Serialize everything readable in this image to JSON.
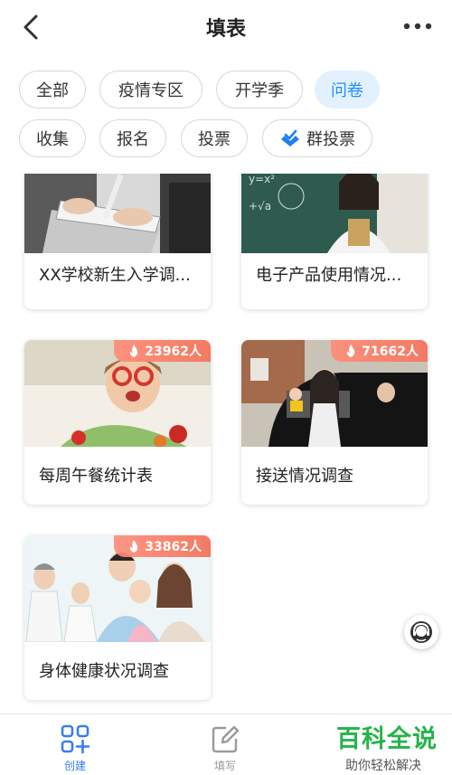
{
  "header": {
    "title": "填表",
    "back_icon": "chevron-left-icon",
    "more_icon": "more-dots-icon"
  },
  "chips": [
    {
      "label": "全部",
      "active": false
    },
    {
      "label": "疫情专区",
      "active": false
    },
    {
      "label": "开学季",
      "active": false
    },
    {
      "label": "问卷",
      "active": true
    },
    {
      "label": "收集",
      "active": false
    },
    {
      "label": "报名",
      "active": false
    },
    {
      "label": "投票",
      "active": false
    },
    {
      "label": "群投票",
      "active": false,
      "icon": "vote-box-icon"
    }
  ],
  "cards": [
    {
      "title": "XX学校新生入学调...",
      "count": ""
    },
    {
      "title": "电子产品使用情况...",
      "count": ""
    },
    {
      "title": "每周午餐统计表",
      "count": "23962人"
    },
    {
      "title": "接送情况调查",
      "count": "71662人"
    },
    {
      "title": "身体健康状况调查",
      "count": "33862人"
    }
  ],
  "tabbar": {
    "tabs": [
      {
        "label": "创建",
        "icon": "create-grid-icon",
        "active": true
      },
      {
        "label": "填写",
        "icon": "edit-icon",
        "active": false
      }
    ]
  },
  "watermark": {
    "title": "百科全说",
    "subtitle": "助你轻松解决"
  },
  "colors": {
    "accent": "#3a7df0",
    "chip_active_bg": "#e3f1fe",
    "chip_active_text": "#1e90ff",
    "badge": "#f27a63",
    "watermark": "#27b34a"
  }
}
